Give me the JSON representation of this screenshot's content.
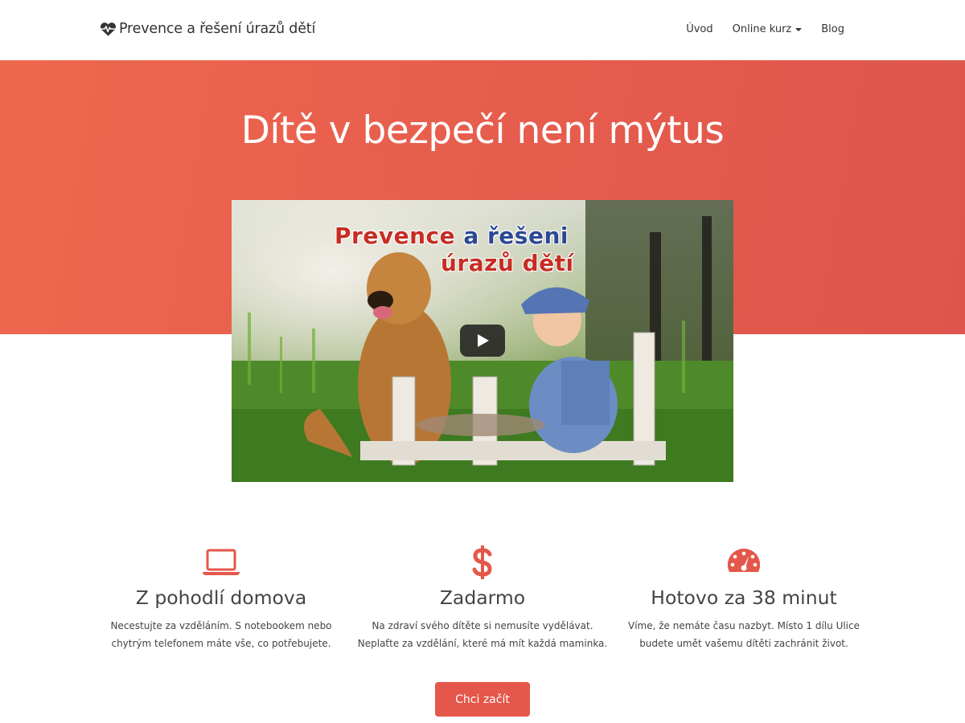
{
  "navbar": {
    "brand_icon": "heartbeat-icon",
    "brand_text": "Prevence a řešení úrazů dětí",
    "items": [
      {
        "label": "Úvod"
      },
      {
        "label": "Online kurz",
        "has_dropdown": true
      },
      {
        "label": "Blog"
      }
    ]
  },
  "hero": {
    "title": "Dítě v bezpečí není mýtus",
    "background_color": "#e65c4d"
  },
  "video": {
    "title_part1": "Prevence",
    "title_part2": "a řešeni",
    "title_part3": "úrazů dětí",
    "play_icon": "play-icon"
  },
  "features": [
    {
      "icon": "laptop-icon",
      "title": "Z pohodlí domova",
      "line1": "Necestujte za vzděláním. S notebookem nebo",
      "line2": "chytrým telefonem máte vše, co potřebujete."
    },
    {
      "icon": "dollar-icon",
      "title": "Zadarmo",
      "line1": "Na zdraví svého dítěte si nemusíte vydělávat.",
      "line2": "Neplaťte za vzdělání, které má mít každá maminka."
    },
    {
      "icon": "dashboard-icon",
      "title": "Hotovo za 38 minut",
      "line1": "Víme, že nemáte času nazbyt. Místo 1 dílu Ulice",
      "line2": "budete umět vašemu dítěti zachránit život."
    }
  ],
  "cta": {
    "label": "Chci začít"
  },
  "colors": {
    "accent": "#e4574a",
    "text": "#333333"
  }
}
